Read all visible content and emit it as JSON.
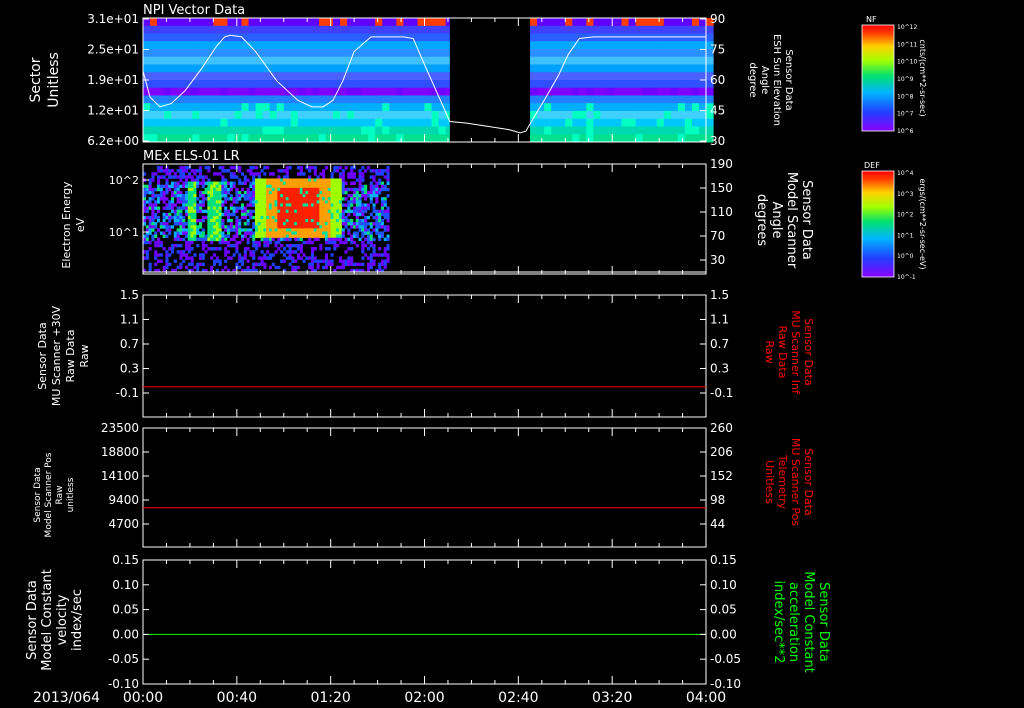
{
  "colors": {
    "frame": "#ffffff",
    "trace_red": "#ff0000",
    "trace_green": "#00ff00",
    "black": "#000000"
  },
  "time_axis": {
    "date_label": "2013/064",
    "ticks": [
      "00:00",
      "00:40",
      "01:20",
      "02:00",
      "02:40",
      "03:20",
      "04:00"
    ],
    "start_hours": 0,
    "end_hours": 4,
    "major_tick_hours": 0.6667,
    "minor_per_major": 4
  },
  "colorbars": [
    {
      "label": "NF",
      "unit_label": "cnts/(cm**2-sr-sec)",
      "max_label": "10^12",
      "tick_labels": [
        "10^12",
        "10^11",
        "10^10",
        "10^9",
        "10^8",
        "10^7",
        "10^6"
      ]
    },
    {
      "label": "DEF",
      "unit_label": "ergs/(cm**2-sr-sec-eV)",
      "max_label": "10^4",
      "tick_labels": [
        "10^4",
        "10^3",
        "10^2",
        "10^1",
        "10^0",
        "10^-1"
      ]
    }
  ],
  "chart_data": [
    {
      "type": "heatmap",
      "title": "NPI Vector Data",
      "ylabel": [
        "Sector",
        "Unitless"
      ],
      "y_tick_labels": [
        "3.1e+01",
        "2.5e+01",
        "1.9e+01",
        "1.2e+01",
        "6.2e+00"
      ],
      "y2label": [
        "Sensor Data",
        "ESH Sun Elevation",
        "Angle",
        "degree"
      ],
      "y2_tick_labels": [
        "90",
        "75",
        "60",
        "45",
        "30"
      ],
      "y2lim": [
        15,
        90
      ],
      "data_gap_hours": [
        2.18,
        2.72
      ],
      "overlay_line": {
        "name": "ESH Sun Elevation Angle",
        "x_hours": [
          0.0,
          0.05,
          0.12,
          0.2,
          0.3,
          0.42,
          0.52,
          0.58,
          0.62,
          0.7,
          0.8,
          0.95,
          1.1,
          1.2,
          1.28,
          1.35,
          1.42,
          1.5,
          1.62,
          1.75,
          1.85,
          1.92,
          2.0,
          2.18,
          2.3,
          2.45,
          2.6,
          2.68,
          2.72,
          2.78,
          2.85,
          2.95,
          3.02,
          3.1,
          3.2,
          4.0
        ],
        "values": [
          58,
          42,
          36,
          38,
          46,
          60,
          73,
          79,
          80,
          79,
          70,
          52,
          40,
          36,
          36,
          40,
          52,
          70,
          79,
          79,
          79,
          78,
          62,
          27,
          26,
          24,
          22,
          20,
          21,
          30,
          40,
          55,
          68,
          78,
          79,
          79
        ]
      }
    },
    {
      "type": "heatmap",
      "title": "MEx ELS-01 LR",
      "ylabel": [
        "Electron Energy",
        "eV"
      ],
      "y_tick_labels": [
        "10^2",
        "10^1"
      ],
      "y2label": [
        "Sensor Data",
        "Model Scanner",
        "Angle",
        "degrees"
      ],
      "y2_tick_labels": [
        "190",
        "150",
        "110",
        "70",
        "30"
      ],
      "data_extent_hours": [
        0.0,
        1.75
      ],
      "intense_region_hours": [
        0.78,
        1.4
      ]
    },
    {
      "type": "line",
      "ylabel": [
        "Sensor Data",
        "MU Scanner +30V",
        "Raw Data",
        "Raw"
      ],
      "y_tick_labels": [
        "1.5",
        "1.1",
        "0.7",
        "0.3",
        "-0.1"
      ],
      "y2label": [
        "Sensor Data",
        "MU Scanner Inf",
        "Raw Data",
        "Raw"
      ],
      "y2_tick_labels": [
        "1.5",
        "1.1",
        "0.7",
        "0.3",
        "-0.1"
      ],
      "ylim": [
        -0.3,
        1.5
      ],
      "series": [
        {
          "name": "Sensor Data MU Scanner Inf Raw Data",
          "x_hours": [
            0,
            4
          ],
          "values": [
            0,
            0
          ]
        }
      ]
    },
    {
      "type": "line",
      "ylabel": [
        "Sensor Data",
        "Model Scanner Pos",
        "Raw",
        "unitless"
      ],
      "y_tick_labels": [
        "23500",
        "18800",
        "14100",
        "9400",
        "4700"
      ],
      "y2label": [
        "Sensor Data",
        "MU Scanner Pos",
        "Telemetry",
        "Unitless"
      ],
      "y2_tick_labels": [
        "260",
        "206",
        "152",
        "98",
        "44"
      ],
      "ylim": [
        0,
        23500
      ],
      "series": [
        {
          "name": "Sensor Data MU Scanner Pos Telemetry",
          "x_hours": [
            0,
            4
          ],
          "values": [
            7880,
            7880
          ]
        }
      ]
    },
    {
      "type": "line",
      "ylabel": [
        "Sensor Data",
        "Model Constant",
        "velocity",
        "index/sec"
      ],
      "y_tick_labels": [
        "0.15",
        "0.10",
        "0.05",
        "0.00",
        "-0.05",
        "-0.10"
      ],
      "y2label": [
        "Sensor Data",
        "Model Constant",
        "acceleration",
        "index/sec**2"
      ],
      "y2_tick_labels": [
        "0.15",
        "0.10",
        "0.05",
        "0.00",
        "-0.05",
        "-0.10"
      ],
      "ylim": [
        -0.1,
        0.15
      ],
      "series": [
        {
          "name": "Sensor Data Model Constant acceleration",
          "x_hours": [
            0,
            4
          ],
          "values": [
            0,
            0
          ]
        }
      ]
    }
  ]
}
